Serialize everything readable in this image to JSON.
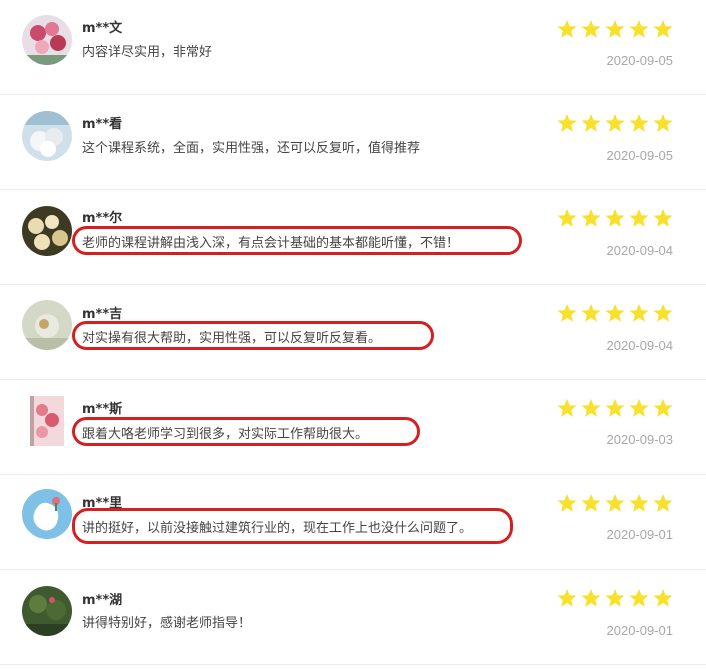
{
  "star_color": "#f7e12c",
  "highlight_color": "#d42020",
  "reviews": [
    {
      "user": "m**文",
      "comment": "内容详尽实用，非常好",
      "rating": 5,
      "date": "2020-09-05",
      "highlighted": false
    },
    {
      "user": "m**看",
      "comment": "这个课程系统，全面，实用性强，还可以反复听，值得推荐",
      "rating": 5,
      "date": "2020-09-05",
      "highlighted": false
    },
    {
      "user": "m**尔",
      "comment": "老师的课程讲解由浅入深，有点会计基础的基本都能听懂，不错！",
      "rating": 5,
      "date": "2020-09-04",
      "highlighted": true
    },
    {
      "user": "m**吉",
      "comment": "对实操有很大帮助，实用性强，可以反复听反复看。",
      "rating": 5,
      "date": "2020-09-04",
      "highlighted": true
    },
    {
      "user": "m**斯",
      "comment": "跟着大咯老师学习到很多，对实际工作帮助很大。",
      "rating": 5,
      "date": "2020-09-03",
      "highlighted": true
    },
    {
      "user": "m**里",
      "comment": "讲的挺好，以前没接触过建筑行业的，现在工作上也没什么问题了。",
      "rating": 5,
      "date": "2020-09-01",
      "highlighted": true
    },
    {
      "user": "m**湖",
      "comment": "讲得特别好，感谢老师指导！",
      "rating": 5,
      "date": "2020-09-01",
      "highlighted": false
    }
  ]
}
